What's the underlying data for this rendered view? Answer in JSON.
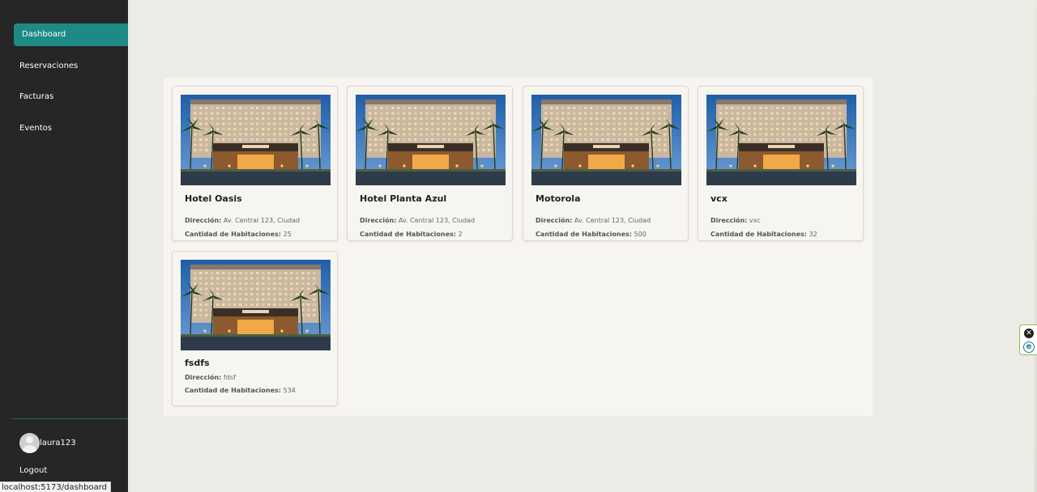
{
  "sidebar": {
    "items": [
      {
        "label": "Dashboard",
        "active": true
      },
      {
        "label": "Reservaciones"
      },
      {
        "label": "Facturas"
      },
      {
        "label": "Eventos"
      }
    ],
    "user": {
      "name": "laura123",
      "icon": "user-avatar-icon"
    },
    "logout_label": "Logout"
  },
  "status_bar": {
    "url": "localhost:5173/dashboard"
  },
  "hotels": [
    {
      "name": "Hotel Oasis",
      "address_label": "Dirección:",
      "address": "Av. Central 123, Ciudad",
      "rooms_label": "Cantidad de Habitaciones:",
      "rooms": "25"
    },
    {
      "name": "Hotel Planta Azul",
      "address_label": "Dirección:",
      "address": "Av. Central 123, Ciudad",
      "rooms_label": "Cantidad de Habitaciones:",
      "rooms": "2"
    },
    {
      "name": "Motorola",
      "address_label": "Dirección:",
      "address": "Av. Central 123, Ciudad",
      "rooms_label": "Cantidad de Habitaciones:",
      "rooms": "500"
    },
    {
      "name": "vcx",
      "address_label": "Dirección:",
      "address": "vxc",
      "rooms_label": "Cantidad de Habitaciones:",
      "rooms": "32"
    },
    {
      "name": "fsdfs",
      "address_label": "Dirección:",
      "address": "fdsf",
      "rooms_label": "Cantidad de Habitaciones:",
      "rooms": "534"
    }
  ],
  "colors": {
    "accent": "#1d8a86",
    "sidebar": "#262626",
    "background": "#ecebe5"
  },
  "edge_widget": {
    "close_icon": "close-icon",
    "extension_icon": "extension-e-icon",
    "close_glyph": "✕",
    "extension_glyph": "e"
  }
}
